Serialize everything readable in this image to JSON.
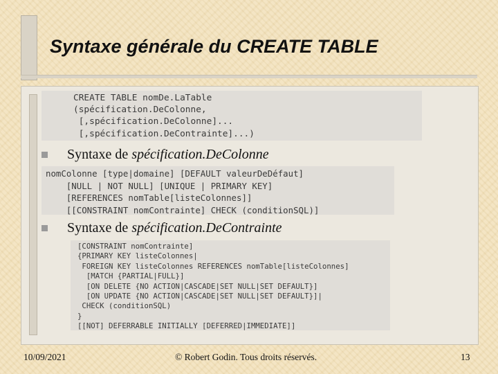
{
  "slide": {
    "title": "Syntaxe générale du CREATE TABLE",
    "code_block_1": "CREATE TABLE nomDe.LaTable\n(spécification.DeColonne,\n [,spécification.DeColonne]...\n [,spécification.DeContrainte]...)",
    "bullet_1": {
      "prefix": "Syntaxe de ",
      "emphasis": "spécification.DeColonne"
    },
    "code_block_2": "nomColonne [type|domaine] [DEFAULT valeurDeDéfaut]\n    [NULL | NOT NULL] [UNIQUE | PRIMARY KEY]\n    [REFERENCES nomTable[listeColonnes]]\n    [[CONSTRAINT nomContrainte] CHECK (conditionSQL)]",
    "bullet_2": {
      "prefix": "Syntaxe de ",
      "emphasis": "spécification.DeContrainte"
    },
    "code_block_3": "[CONSTRAINT nomContrainte]\n{PRIMARY KEY listeColonnes|\n FOREIGN KEY listeColonnes REFERENCES nomTable[listeColonnes]\n  [MATCH {PARTIAL|FULL}]\n  [ON DELETE {NO ACTION|CASCADE|SET NULL|SET DEFAULT}]\n  [ON UPDATE {NO ACTION|CASCADE|SET NULL|SET DEFAULT}]|\n CHECK (conditionSQL)\n}\n[[NOT] DEFERRABLE INITIALLY [DEFERRED|IMMEDIATE]]"
  },
  "footer": {
    "date": "10/09/2021",
    "copyright": "© Robert Godin. Tous droits réservés.",
    "page_number": "13"
  }
}
